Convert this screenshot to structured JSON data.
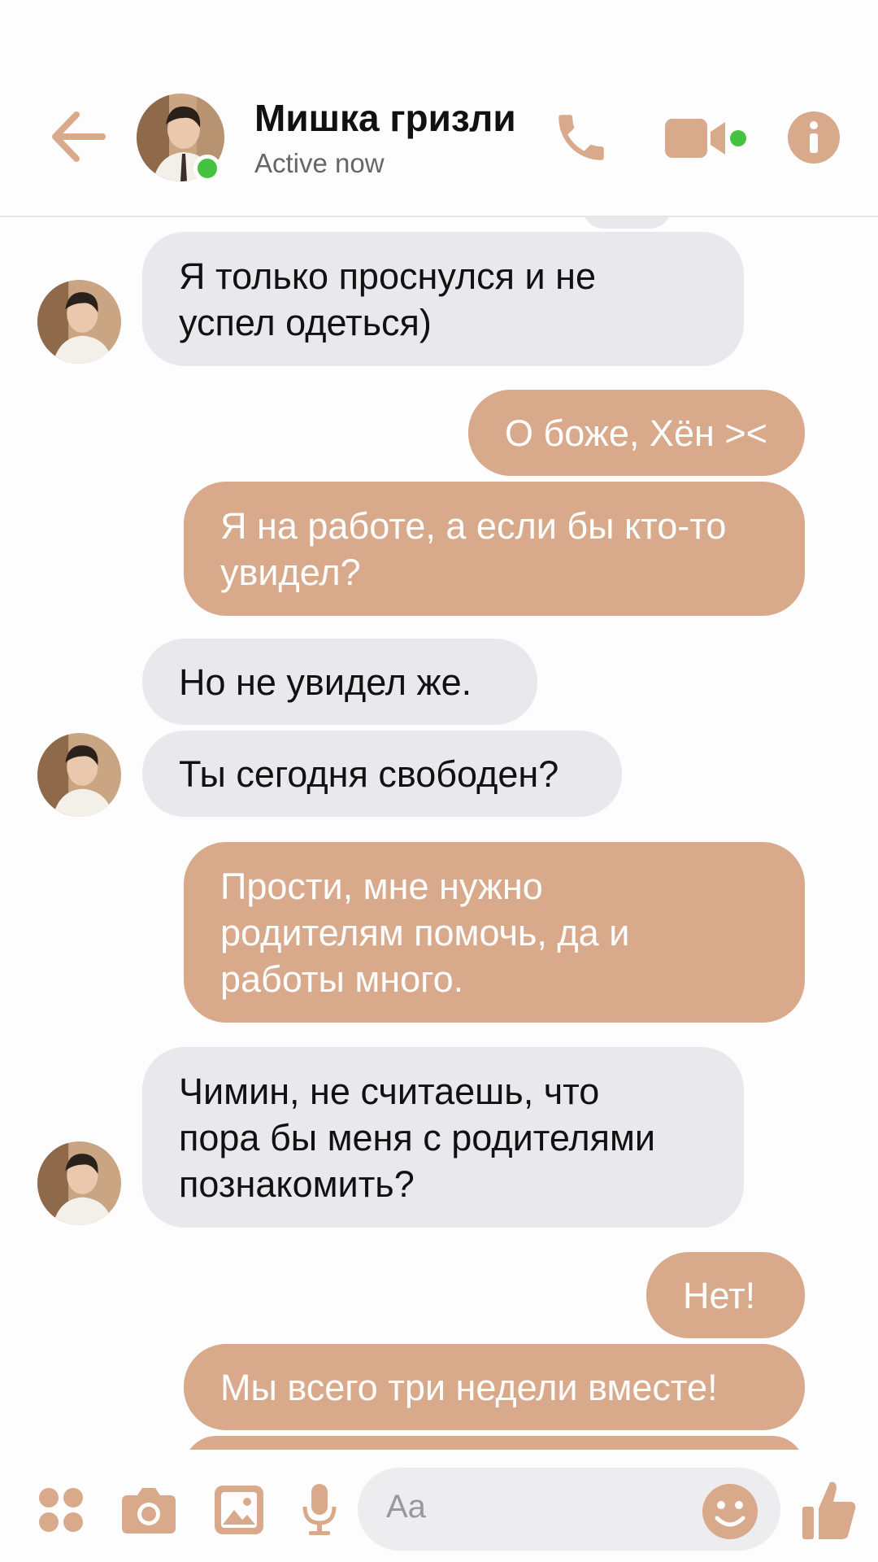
{
  "header": {
    "contact_name": "Мишка гризли",
    "status": "Active now",
    "accent_color": "#d8a98a",
    "online_color": "#45c23f",
    "icons": [
      "back-arrow-icon",
      "phone-icon",
      "video-camera-icon",
      "info-icon"
    ]
  },
  "messages": [
    {
      "from": "them",
      "text": "Я только проснулся и не\nуспел одеться)"
    },
    {
      "from": "me",
      "text": "О боже, Хён ><"
    },
    {
      "from": "me",
      "text": "Я на работе, а если бы кто-то\nувидел?"
    },
    {
      "from": "them",
      "text": "Но не увидел же."
    },
    {
      "from": "them",
      "text": "Ты сегодня свободен?"
    },
    {
      "from": "me",
      "text": "Прости, мне нужно\nродителям помочь, да и\nработы много."
    },
    {
      "from": "them",
      "text": "Чимин, не считаешь, что\nпора бы меня с родителями\nпознакомить?"
    },
    {
      "from": "me",
      "text": "Нет!"
    },
    {
      "from": "me",
      "text": "Мы всего три недели вместе!"
    }
  ],
  "composer": {
    "placeholder": "Aa",
    "icons": [
      "apps-icon",
      "camera-icon",
      "gallery-icon",
      "microphone-icon",
      "emoji-icon",
      "thumbs-up-icon"
    ]
  }
}
